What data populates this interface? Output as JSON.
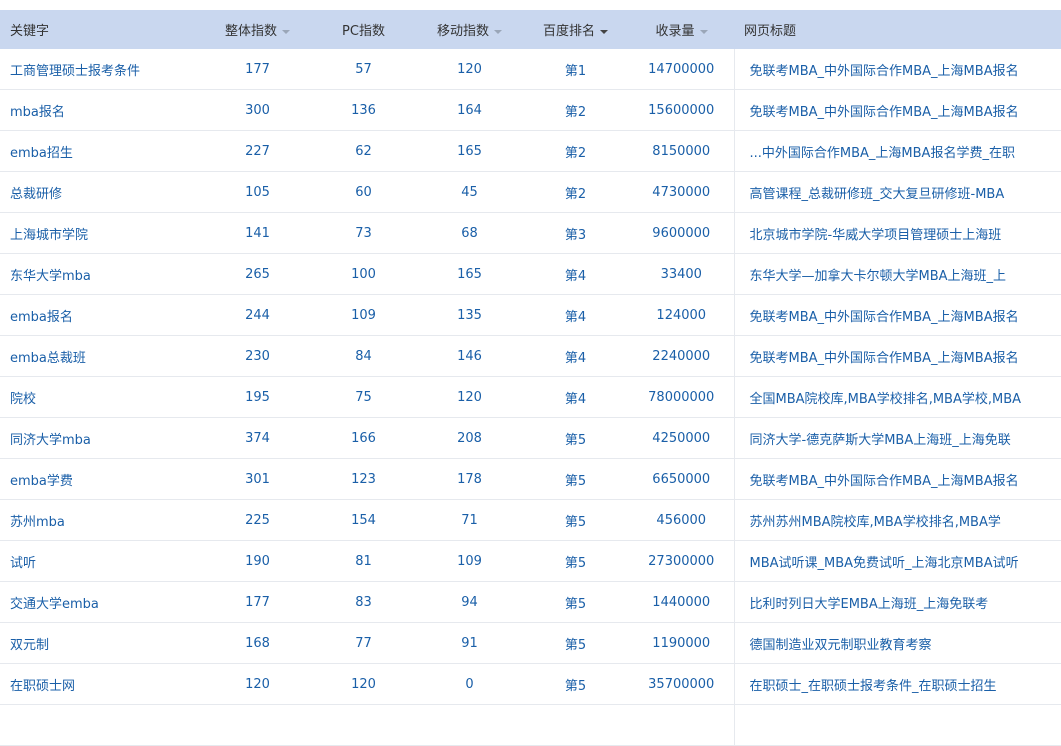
{
  "table": {
    "headers": {
      "keyword": "关键字",
      "overall": "整体指数",
      "pc": "PC指数",
      "mobile": "移动指数",
      "rank": "百度排名",
      "indexed": "收录量",
      "title": "网页标题"
    },
    "rows": [
      {
        "keyword": "工商管理硕士报考条件",
        "overall": "177",
        "pc": "57",
        "mobile": "120",
        "rank": "第1",
        "indexed": "14700000",
        "title": "免联考MBA_中外国际合作MBA_上海MBA报名"
      },
      {
        "keyword": "mba报名",
        "overall": "300",
        "pc": "136",
        "mobile": "164",
        "rank": "第2",
        "indexed": "15600000",
        "title": "免联考MBA_中外国际合作MBA_上海MBA报名"
      },
      {
        "keyword": "emba招生",
        "overall": "227",
        "pc": "62",
        "mobile": "165",
        "rank": "第2",
        "indexed": "8150000",
        "title": "...中外国际合作MBA_上海MBA报名学费_在职"
      },
      {
        "keyword": "总裁研修",
        "overall": "105",
        "pc": "60",
        "mobile": "45",
        "rank": "第2",
        "indexed": "4730000",
        "title": "高管课程_总裁研修班_交大复旦研修班-MBA"
      },
      {
        "keyword": "上海城市学院",
        "overall": "141",
        "pc": "73",
        "mobile": "68",
        "rank": "第3",
        "indexed": "9600000",
        "title": "北京城市学院-华威大学项目管理硕士上海班"
      },
      {
        "keyword": "东华大学mba",
        "overall": "265",
        "pc": "100",
        "mobile": "165",
        "rank": "第4",
        "indexed": "33400",
        "title": "东华大学—加拿大卡尔顿大学MBA上海班_上"
      },
      {
        "keyword": "emba报名",
        "overall": "244",
        "pc": "109",
        "mobile": "135",
        "rank": "第4",
        "indexed": "124000",
        "title": "免联考MBA_中外国际合作MBA_上海MBA报名"
      },
      {
        "keyword": "emba总裁班",
        "overall": "230",
        "pc": "84",
        "mobile": "146",
        "rank": "第4",
        "indexed": "2240000",
        "title": "免联考MBA_中外国际合作MBA_上海MBA报名"
      },
      {
        "keyword": "院校",
        "overall": "195",
        "pc": "75",
        "mobile": "120",
        "rank": "第4",
        "indexed": "78000000",
        "title": "全国MBA院校库,MBA学校排名,MBA学校,MBA"
      },
      {
        "keyword": "同济大学mba",
        "overall": "374",
        "pc": "166",
        "mobile": "208",
        "rank": "第5",
        "indexed": "4250000",
        "title": "同济大学-德克萨斯大学MBA上海班_上海免联"
      },
      {
        "keyword": "emba学费",
        "overall": "301",
        "pc": "123",
        "mobile": "178",
        "rank": "第5",
        "indexed": "6650000",
        "title": "免联考MBA_中外国际合作MBA_上海MBA报名"
      },
      {
        "keyword": "苏州mba",
        "overall": "225",
        "pc": "154",
        "mobile": "71",
        "rank": "第5",
        "indexed": "456000",
        "title": "苏州苏州MBA院校库,MBA学校排名,MBA学"
      },
      {
        "keyword": "试听",
        "overall": "190",
        "pc": "81",
        "mobile": "109",
        "rank": "第5",
        "indexed": "27300000",
        "title": "MBA试听课_MBA免费试听_上海北京MBA试听"
      },
      {
        "keyword": "交通大学emba",
        "overall": "177",
        "pc": "83",
        "mobile": "94",
        "rank": "第5",
        "indexed": "1440000",
        "title": "比利时列日大学EMBA上海班_上海免联考"
      },
      {
        "keyword": "双元制",
        "overall": "168",
        "pc": "77",
        "mobile": "91",
        "rank": "第5",
        "indexed": "1190000",
        "title": "德国制造业双元制职业教育考察"
      },
      {
        "keyword": "在职硕士网",
        "overall": "120",
        "pc": "120",
        "mobile": "0",
        "rank": "第5",
        "indexed": "35700000",
        "title": "在职硕士_在职硕士报考条件_在职硕士招生"
      },
      {
        "keyword": "",
        "overall": "",
        "pc": "",
        "mobile": "",
        "rank": "",
        "indexed": "",
        "title": ""
      }
    ]
  }
}
